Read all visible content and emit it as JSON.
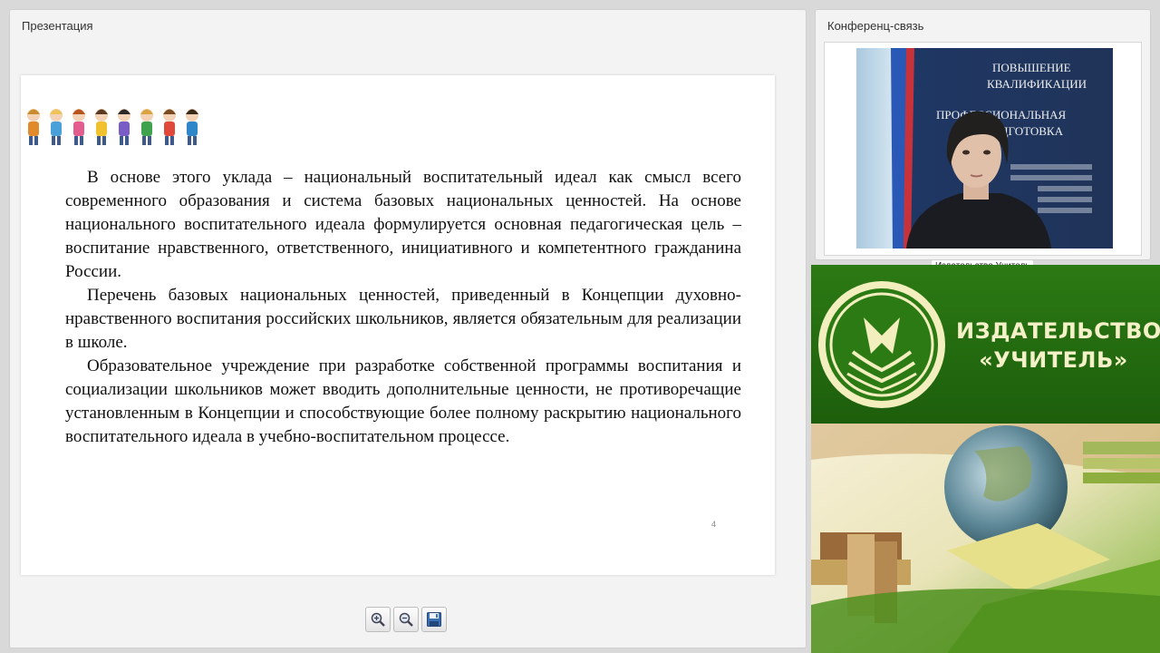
{
  "presentation": {
    "title": "Презентация",
    "slide": {
      "paragraphs": [
        "В основе этого уклада – национальный воспитательный идеал как смысл всего современного образования и система базовых национальных ценностей. На основе национального воспитательного идеала формулируется основная педагогическая цель – воспитание нравственного, ответственного, инициативного и компетентного гражданина России.",
        "Перечень базовых национальных ценностей, приведенный в Концепции духовно-нравственного воспитания российских школьников, является обязательным для реализации в школе.",
        "Образовательное учреждение при разработке собственной программы воспитания и социализации школьников может вводить дополнительные ценности, не противоречащие установленным в Концепции и способствующие более полному раскрытию национального воспитательного идеала в учебно-воспитательном процессе."
      ],
      "page_number": "4"
    },
    "toolbar": {
      "zoom_in_icon": "zoom-in-icon",
      "zoom_out_icon": "zoom-out-icon",
      "save_icon": "save-icon"
    }
  },
  "conference": {
    "title": "Конференц-связь",
    "video_label": "Издательство Учитель",
    "banner_lines": [
      "ПОВЫШЕНИЕ",
      "КВАЛИФИКАЦИИ",
      "ПРОФЕССИОНАЛЬНАЯ",
      "ПЕРЕПОДГОТОВКА"
    ]
  },
  "brand": {
    "line1": "ИЗДАТЕЛЬСТВО",
    "line2": "«УЧИТЕЛЬ»",
    "colors": {
      "green": "#2c7a14",
      "cream": "#f4f0c8"
    }
  }
}
